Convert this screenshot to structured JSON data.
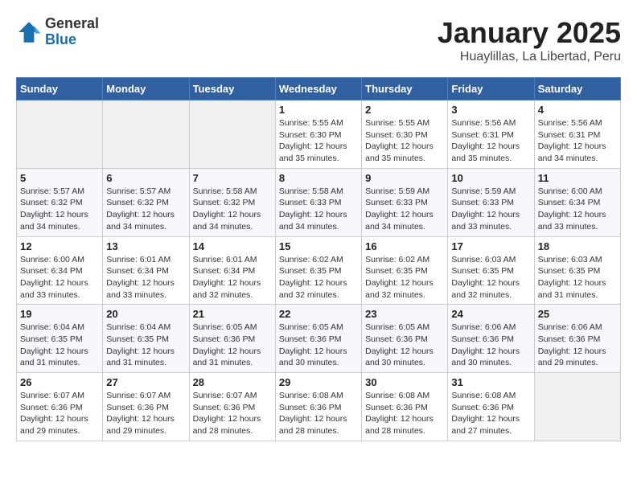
{
  "logo": {
    "general": "General",
    "blue": "Blue"
  },
  "header": {
    "title": "January 2025",
    "subtitle": "Huaylillas, La Libertad, Peru"
  },
  "weekdays": [
    "Sunday",
    "Monday",
    "Tuesday",
    "Wednesday",
    "Thursday",
    "Friday",
    "Saturday"
  ],
  "weeks": [
    [
      {
        "day": "",
        "info": ""
      },
      {
        "day": "",
        "info": ""
      },
      {
        "day": "",
        "info": ""
      },
      {
        "day": "1",
        "info": "Sunrise: 5:55 AM\nSunset: 6:30 PM\nDaylight: 12 hours and 35 minutes."
      },
      {
        "day": "2",
        "info": "Sunrise: 5:55 AM\nSunset: 6:30 PM\nDaylight: 12 hours and 35 minutes."
      },
      {
        "day": "3",
        "info": "Sunrise: 5:56 AM\nSunset: 6:31 PM\nDaylight: 12 hours and 35 minutes."
      },
      {
        "day": "4",
        "info": "Sunrise: 5:56 AM\nSunset: 6:31 PM\nDaylight: 12 hours and 34 minutes."
      }
    ],
    [
      {
        "day": "5",
        "info": "Sunrise: 5:57 AM\nSunset: 6:32 PM\nDaylight: 12 hours and 34 minutes."
      },
      {
        "day": "6",
        "info": "Sunrise: 5:57 AM\nSunset: 6:32 PM\nDaylight: 12 hours and 34 minutes."
      },
      {
        "day": "7",
        "info": "Sunrise: 5:58 AM\nSunset: 6:32 PM\nDaylight: 12 hours and 34 minutes."
      },
      {
        "day": "8",
        "info": "Sunrise: 5:58 AM\nSunset: 6:33 PM\nDaylight: 12 hours and 34 minutes."
      },
      {
        "day": "9",
        "info": "Sunrise: 5:59 AM\nSunset: 6:33 PM\nDaylight: 12 hours and 34 minutes."
      },
      {
        "day": "10",
        "info": "Sunrise: 5:59 AM\nSunset: 6:33 PM\nDaylight: 12 hours and 33 minutes."
      },
      {
        "day": "11",
        "info": "Sunrise: 6:00 AM\nSunset: 6:34 PM\nDaylight: 12 hours and 33 minutes."
      }
    ],
    [
      {
        "day": "12",
        "info": "Sunrise: 6:00 AM\nSunset: 6:34 PM\nDaylight: 12 hours and 33 minutes."
      },
      {
        "day": "13",
        "info": "Sunrise: 6:01 AM\nSunset: 6:34 PM\nDaylight: 12 hours and 33 minutes."
      },
      {
        "day": "14",
        "info": "Sunrise: 6:01 AM\nSunset: 6:34 PM\nDaylight: 12 hours and 32 minutes."
      },
      {
        "day": "15",
        "info": "Sunrise: 6:02 AM\nSunset: 6:35 PM\nDaylight: 12 hours and 32 minutes."
      },
      {
        "day": "16",
        "info": "Sunrise: 6:02 AM\nSunset: 6:35 PM\nDaylight: 12 hours and 32 minutes."
      },
      {
        "day": "17",
        "info": "Sunrise: 6:03 AM\nSunset: 6:35 PM\nDaylight: 12 hours and 32 minutes."
      },
      {
        "day": "18",
        "info": "Sunrise: 6:03 AM\nSunset: 6:35 PM\nDaylight: 12 hours and 31 minutes."
      }
    ],
    [
      {
        "day": "19",
        "info": "Sunrise: 6:04 AM\nSunset: 6:35 PM\nDaylight: 12 hours and 31 minutes."
      },
      {
        "day": "20",
        "info": "Sunrise: 6:04 AM\nSunset: 6:35 PM\nDaylight: 12 hours and 31 minutes."
      },
      {
        "day": "21",
        "info": "Sunrise: 6:05 AM\nSunset: 6:36 PM\nDaylight: 12 hours and 31 minutes."
      },
      {
        "day": "22",
        "info": "Sunrise: 6:05 AM\nSunset: 6:36 PM\nDaylight: 12 hours and 30 minutes."
      },
      {
        "day": "23",
        "info": "Sunrise: 6:05 AM\nSunset: 6:36 PM\nDaylight: 12 hours and 30 minutes."
      },
      {
        "day": "24",
        "info": "Sunrise: 6:06 AM\nSunset: 6:36 PM\nDaylight: 12 hours and 30 minutes."
      },
      {
        "day": "25",
        "info": "Sunrise: 6:06 AM\nSunset: 6:36 PM\nDaylight: 12 hours and 29 minutes."
      }
    ],
    [
      {
        "day": "26",
        "info": "Sunrise: 6:07 AM\nSunset: 6:36 PM\nDaylight: 12 hours and 29 minutes."
      },
      {
        "day": "27",
        "info": "Sunrise: 6:07 AM\nSunset: 6:36 PM\nDaylight: 12 hours and 29 minutes."
      },
      {
        "day": "28",
        "info": "Sunrise: 6:07 AM\nSunset: 6:36 PM\nDaylight: 12 hours and 28 minutes."
      },
      {
        "day": "29",
        "info": "Sunrise: 6:08 AM\nSunset: 6:36 PM\nDaylight: 12 hours and 28 minutes."
      },
      {
        "day": "30",
        "info": "Sunrise: 6:08 AM\nSunset: 6:36 PM\nDaylight: 12 hours and 28 minutes."
      },
      {
        "day": "31",
        "info": "Sunrise: 6:08 AM\nSunset: 6:36 PM\nDaylight: 12 hours and 27 minutes."
      },
      {
        "day": "",
        "info": ""
      }
    ]
  ]
}
